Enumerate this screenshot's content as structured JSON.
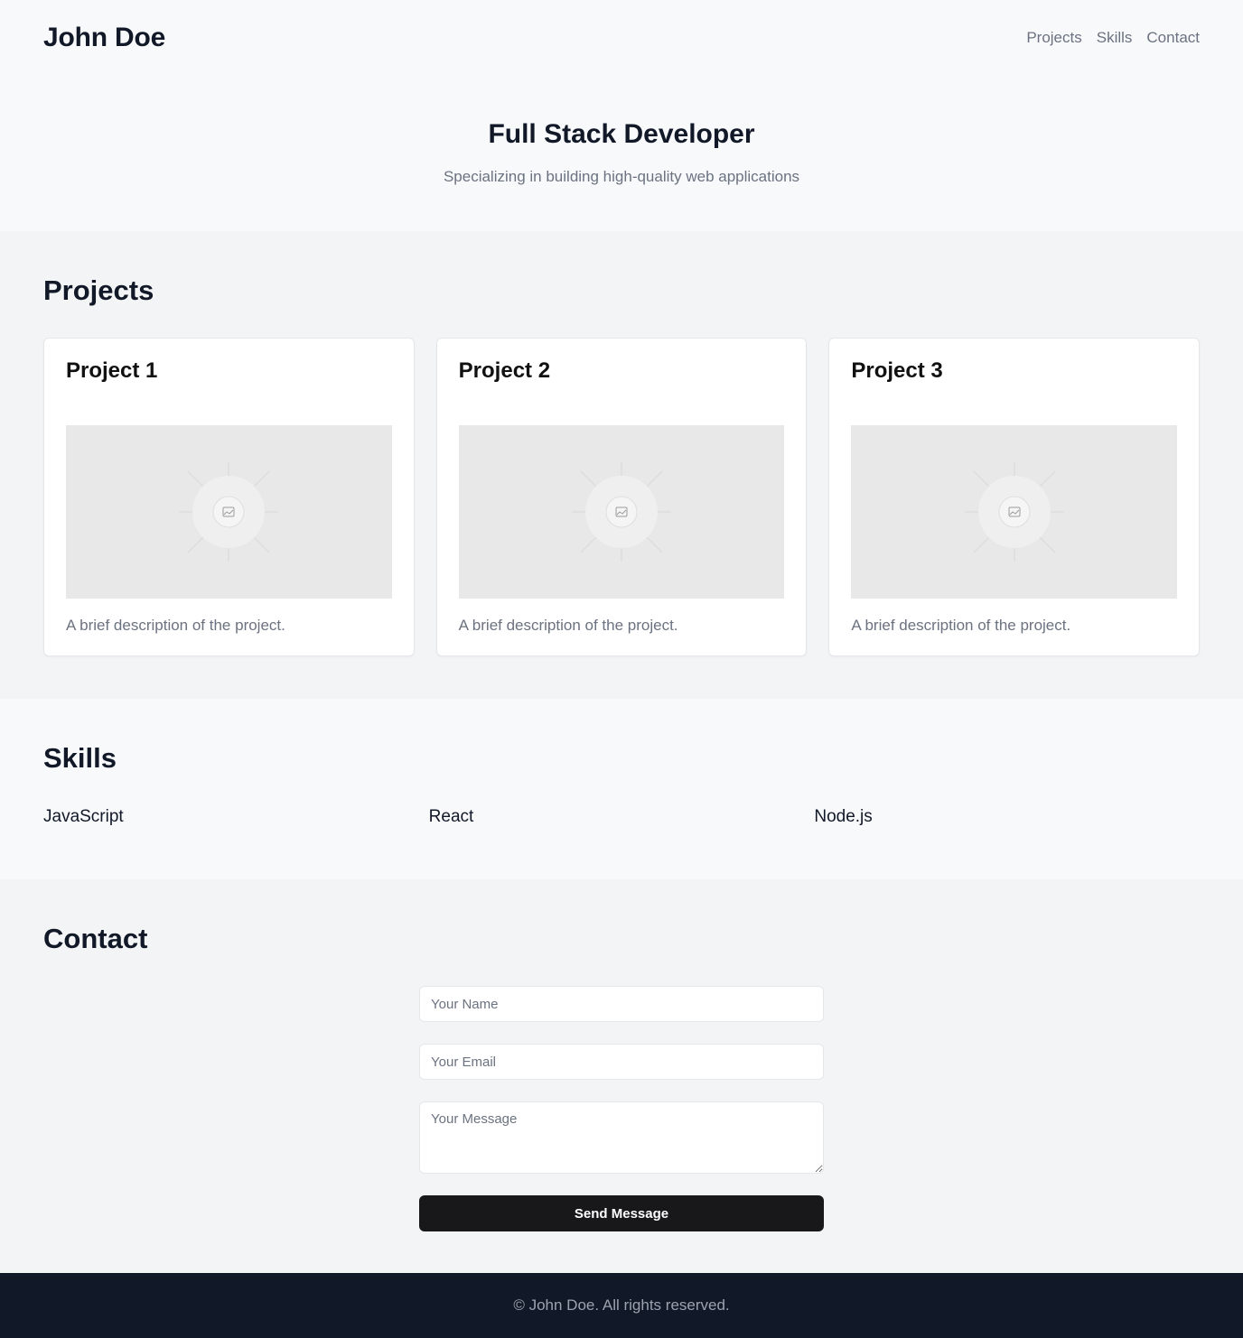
{
  "header": {
    "name": "John Doe",
    "nav": [
      "Projects",
      "Skills",
      "Contact"
    ]
  },
  "hero": {
    "title": "Full Stack Developer",
    "subtitle": "Specializing in building high-quality web applications"
  },
  "projects": {
    "title": "Projects",
    "items": [
      {
        "title": "Project 1",
        "description": "A brief description of the project."
      },
      {
        "title": "Project 2",
        "description": "A brief description of the project."
      },
      {
        "title": "Project 3",
        "description": "A brief description of the project."
      }
    ]
  },
  "skills": {
    "title": "Skills",
    "items": [
      "JavaScript",
      "React",
      "Node.js"
    ]
  },
  "contact": {
    "title": "Contact",
    "name_placeholder": "Your Name",
    "email_placeholder": "Your Email",
    "message_placeholder": "Your Message",
    "submit_label": "Send Message"
  },
  "footer": {
    "text": "© John Doe. All rights reserved."
  },
  "colors": {
    "primary_text": "#111827",
    "muted_text": "#6b7280",
    "button_bg": "#18181b",
    "footer_bg": "#111827"
  }
}
